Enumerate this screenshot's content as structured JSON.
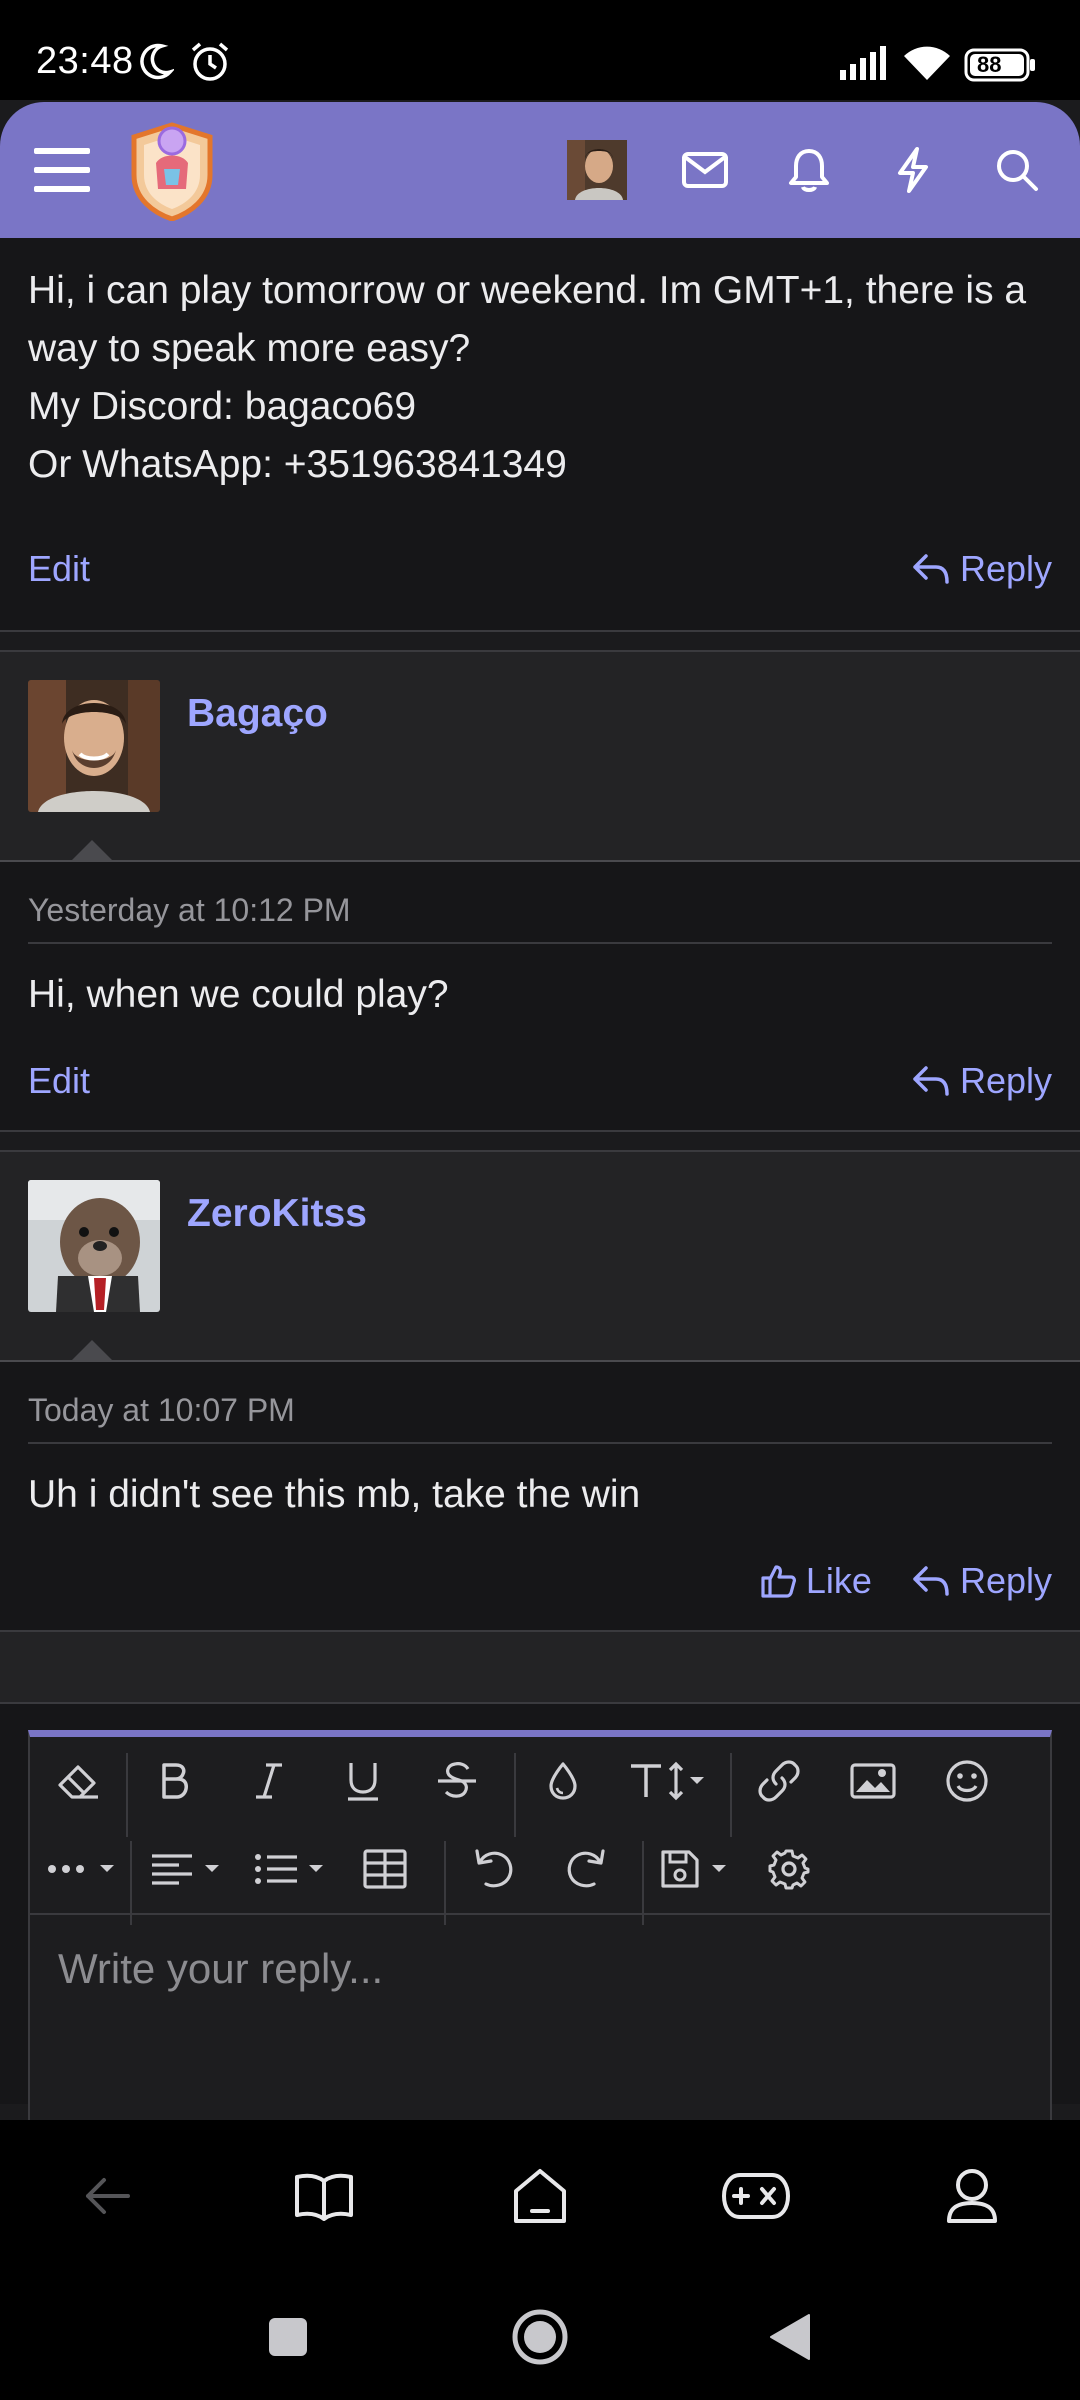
{
  "status_bar": {
    "time": "23:48",
    "battery": "88"
  },
  "header": {
    "menu_icon": "hamburger-menu-icon",
    "logo_icon": "crest-logo-icon",
    "avatar_icon": "user-avatar-icon",
    "icons": [
      "envelope-icon",
      "bell-icon",
      "lightning-icon",
      "search-icon"
    ],
    "accent": "#7a75c6"
  },
  "posts": [
    {
      "body": "Hi, i can play tomorrow or weekend. Im GMT+1, there is a way to speak more easy?\nMy Discord: bagaco69\nOr WhatsApp: +351963841349",
      "edit_label": "Edit",
      "reply_label": "Reply"
    },
    {
      "username": "Bagaço",
      "date": "Yesterday at 10:12 PM",
      "body": "Hi, when we could play?",
      "edit_label": "Edit",
      "reply_label": "Reply"
    },
    {
      "username": "ZeroKitss",
      "date": "Today at 10:07 PM",
      "body": "Uh i didn't see this mb, take the win",
      "like_label": "Like",
      "reply_label": "Reply"
    }
  ],
  "editor": {
    "placeholder": "Write your reply...",
    "toolbar_row1": [
      "eraser-icon",
      "bold-icon",
      "italic-icon",
      "underline-icon",
      "strikethrough-icon",
      "text-color-icon",
      "font-size-icon",
      "link-icon",
      "image-icon",
      "emoji-icon"
    ],
    "toolbar_row2": [
      "more-options-icon",
      "align-icon",
      "list-icon",
      "table-icon",
      "undo-icon",
      "redo-icon",
      "save-draft-icon",
      "settings-icon"
    ]
  },
  "bottom_nav": [
    "back-arrow-icon",
    "book-icon",
    "home-icon",
    "gamepad-icon",
    "profile-icon"
  ],
  "system_nav": [
    "recents-square-icon",
    "home-circle-icon",
    "back-triangle-icon"
  ]
}
